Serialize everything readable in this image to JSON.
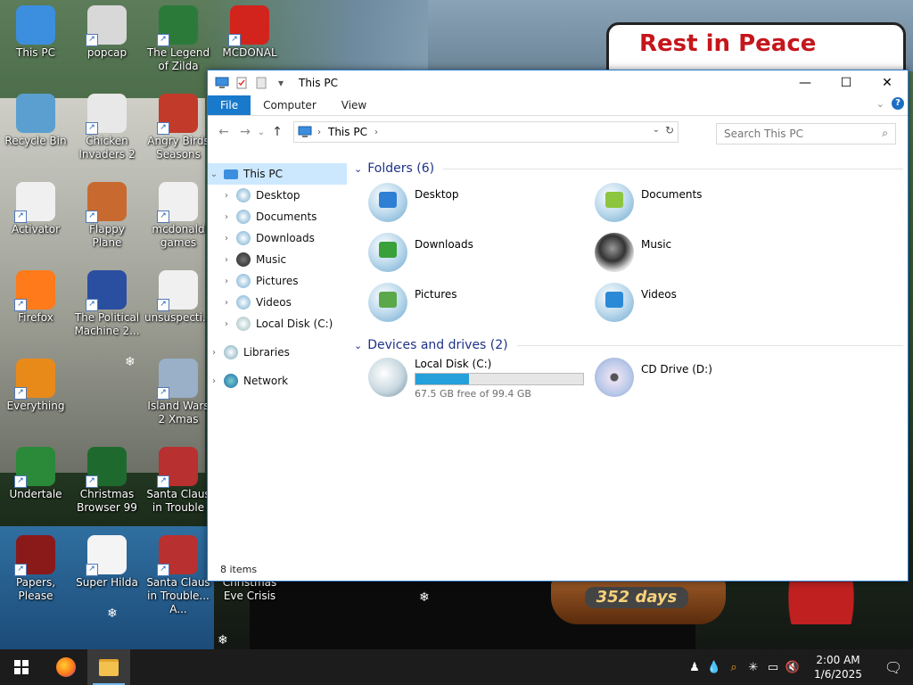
{
  "desktop": {
    "icons": [
      {
        "label": "This PC",
        "color": "#3c8ede"
      },
      {
        "label": "popcap",
        "color": "#d8d8d8"
      },
      {
        "label": "The Legend of Zilda",
        "color": "#2c7a3a"
      },
      {
        "label": "MCDONAL",
        "color": "#d2241c"
      },
      {
        "label": "Recycle Bin",
        "color": "#5a9fd0"
      },
      {
        "label": "Chicken Invaders 2",
        "color": "#e8e8e8"
      },
      {
        "label": "Angry Birds Seasons",
        "color": "#c23a2a"
      },
      {
        "label": "Activator",
        "color": "#f0f0f0"
      },
      {
        "label": "Flappy Plane",
        "color": "#c86a30"
      },
      {
        "label": "mcdonald games",
        "color": "#f0f0f0"
      },
      {
        "label": "Firefox",
        "color": "#ff7a1a"
      },
      {
        "label": "The Political Machine 2...",
        "color": "#2a4ea0"
      },
      {
        "label": "unsuspecti...",
        "color": "#f0f0f0"
      },
      {
        "label": "Everything",
        "color": "#e88a1a"
      },
      {
        "label": "Island Wars 2 Xmas",
        "color": "#9ab0c8"
      },
      {
        "label": "Undertale",
        "color": "#2a8a3a"
      },
      {
        "label": "Christmas Browser 99",
        "color": "#1e6a2e"
      },
      {
        "label": "Santa Claus in Trouble",
        "color": "#b83030"
      },
      {
        "label": "Papers, Please",
        "color": "#8a1a1a"
      },
      {
        "label": "Super Hilda",
        "color": "#f4f4f4"
      },
      {
        "label": "Santa Claus in Trouble... A...",
        "color": "#b83030"
      },
      {
        "label": "Christmas Eve Crisis",
        "color": "#1e3a6a"
      }
    ],
    "wallpaper_sign": "Rest in Peace",
    "countdown": "352 days"
  },
  "explorer": {
    "title": "This PC",
    "tabs": {
      "file": "File",
      "computer": "Computer",
      "view": "View"
    },
    "address": "This PC",
    "search_placeholder": "Search This PC",
    "nav": {
      "this_pc": "This PC",
      "desktop": "Desktop",
      "documents": "Documents",
      "downloads": "Downloads",
      "music": "Music",
      "pictures": "Pictures",
      "videos": "Videos",
      "local_disk": "Local Disk (C:)",
      "libraries": "Libraries",
      "network": "Network"
    },
    "folders_header": "Folders (6)",
    "folders": {
      "desktop": "Desktop",
      "documents": "Documents",
      "downloads": "Downloads",
      "music": "Music",
      "pictures": "Pictures",
      "videos": "Videos"
    },
    "drives_header": "Devices and drives (2)",
    "drives": {
      "c_name": "Local Disk (C:)",
      "c_free": "67.5 GB free of 99.4 GB",
      "c_used_fraction": 0.32,
      "d_name": "CD Drive (D:)"
    },
    "status": "8 items"
  },
  "taskbar": {
    "time": "2:00 AM",
    "date": "1/6/2025"
  }
}
